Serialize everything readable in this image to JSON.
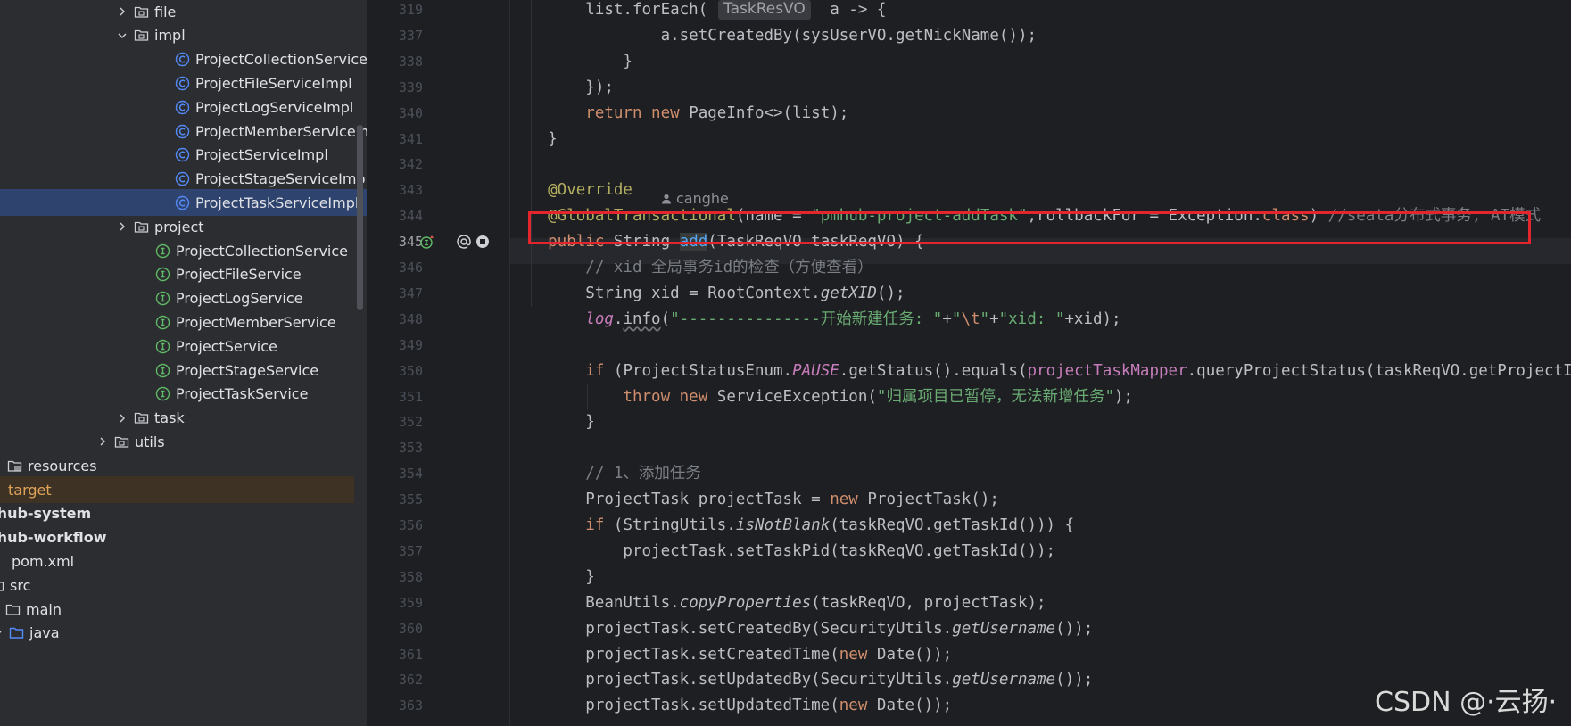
{
  "tree": [
    {
      "label": "file",
      "kind": "folder",
      "indent": 150,
      "chevron": "right"
    },
    {
      "label": "impl",
      "kind": "folder",
      "indent": 150,
      "chevron": "down"
    },
    {
      "label": "ProjectCollectionServiceImpl",
      "kind": "class",
      "indent": 196
    },
    {
      "label": "ProjectFileServiceImpl",
      "kind": "class",
      "indent": 196
    },
    {
      "label": "ProjectLogServiceImpl",
      "kind": "class",
      "indent": 196
    },
    {
      "label": "ProjectMemberServiceImpl",
      "kind": "class",
      "indent": 196
    },
    {
      "label": "ProjectServiceImpl",
      "kind": "class",
      "indent": 196
    },
    {
      "label": "ProjectStageServiceImpl",
      "kind": "class",
      "indent": 196
    },
    {
      "label": "ProjectTaskServiceImpl",
      "kind": "class",
      "indent": 196,
      "selected": true
    },
    {
      "label": "project",
      "kind": "folder",
      "indent": 150,
      "chevron": "right"
    },
    {
      "label": "ProjectCollectionService",
      "kind": "interface",
      "indent": 174
    },
    {
      "label": "ProjectFileService",
      "kind": "interface",
      "indent": 174
    },
    {
      "label": "ProjectLogService",
      "kind": "interface",
      "indent": 174
    },
    {
      "label": "ProjectMemberService",
      "kind": "interface",
      "indent": 174
    },
    {
      "label": "ProjectService",
      "kind": "interface",
      "indent": 174
    },
    {
      "label": "ProjectStageService",
      "kind": "interface",
      "indent": 174
    },
    {
      "label": "ProjectTaskService",
      "kind": "interface",
      "indent": 174
    },
    {
      "label": "task",
      "kind": "folder",
      "indent": 150,
      "chevron": "right"
    },
    {
      "label": "utils",
      "kind": "folder",
      "indent": 128,
      "chevron": "right"
    },
    {
      "label": "resources",
      "kind": "resfolder",
      "indent": 8,
      "chevron": "right"
    },
    {
      "label": "target",
      "kind": "target",
      "indent": -14,
      "target": true
    },
    {
      "label": "mhub-system",
      "kind": "module",
      "indent": -20,
      "bold": true
    },
    {
      "label": "mhub-workflow",
      "kind": "module",
      "indent": -20,
      "bold": true
    },
    {
      "label": "pom.xml",
      "kind": "pom",
      "indent": -10
    },
    {
      "label": "src",
      "kind": "folderplain",
      "indent": -12
    },
    {
      "label": "main",
      "kind": "folderplain",
      "indent": 6
    },
    {
      "label": "java",
      "kind": "bluefolder",
      "indent": 10,
      "chevron": "down"
    }
  ],
  "line_numbers": [
    "319",
    "337",
    "338",
    "339",
    "340",
    "341",
    "342",
    "343",
    "344",
    "345",
    "346",
    "347",
    "348",
    "349",
    "350",
    "351",
    "352",
    "353",
    "354",
    "355",
    "356",
    "357",
    "358",
    "359",
    "360",
    "361",
    "362",
    "363"
  ],
  "current_line": "345",
  "type_hint": "TaskResVO",
  "author_hint": "canghe",
  "watermark": "CSDN @·云扬·",
  "code": [
    [
      [
        "fn",
        "        list.forEach("
      ],
      [
        "hint",
        "            "
      ],
      [
        "fn",
        " a -> {"
      ]
    ],
    [
      [
        "fn",
        "                a.setCreatedBy(sysUserVO.getNickName());"
      ]
    ],
    [
      [
        "fn",
        "            }"
      ]
    ],
    [
      [
        "fn",
        "        });"
      ]
    ],
    [
      [
        "kw",
        "        return new "
      ],
      [
        "fn",
        "PageInfo<>(list);"
      ]
    ],
    [
      [
        "fn",
        "    }"
      ]
    ],
    [
      [
        "fn",
        ""
      ]
    ],
    [
      [
        "ann",
        "    @Override"
      ]
    ],
    [
      [
        "ann",
        "    @GlobalTransactional"
      ],
      [
        "fn",
        "(name = "
      ],
      [
        "str",
        "\"pmhub-project-addTask\""
      ],
      [
        "fn",
        ",rollbackFor = Exception."
      ],
      [
        "kw",
        "class"
      ],
      [
        "fn",
        ") "
      ],
      [
        "cmt",
        "//seata分布式事务, AT模式"
      ]
    ],
    [
      [
        "kw",
        "    public "
      ],
      [
        "fn",
        "String "
      ],
      [
        "meth",
        "add"
      ],
      [
        "fn",
        "(TaskReqVO taskReqVO) {"
      ]
    ],
    [
      [
        "cmt",
        "        // xid 全局事务id的检查（方便查看）"
      ]
    ],
    [
      [
        "fn",
        "        String xid = RootContext."
      ],
      [
        "ital",
        "getXID"
      ],
      [
        "fn",
        "();"
      ]
    ],
    [
      [
        "fld",
        "        log"
      ],
      [
        "fn",
        "."
      ],
      [
        "wavy",
        "info"
      ],
      [
        "fn",
        "("
      ],
      [
        "str",
        "\"---------------开始新建任务: \""
      ],
      [
        "fn",
        "+"
      ],
      [
        "str",
        "\""
      ],
      [
        "esc",
        "\\t"
      ],
      [
        "str",
        "\""
      ],
      [
        "fn",
        "+"
      ],
      [
        "str",
        "\"xid: \""
      ],
      [
        "fn",
        "+xid);"
      ]
    ],
    [
      [
        "fn",
        ""
      ]
    ],
    [
      [
        "kw",
        "        if "
      ],
      [
        "fn",
        "(ProjectStatusEnum."
      ],
      [
        "fld",
        "PAUSE"
      ],
      [
        "fn",
        ".getStatus().equals("
      ],
      [
        "fldn",
        "projectTaskMapper"
      ],
      [
        "fn",
        ".queryProjectStatus(taskReqVO.getProjectId()))) {"
      ]
    ],
    [
      [
        "kw",
        "            throw new "
      ],
      [
        "fn",
        "ServiceException("
      ],
      [
        "str",
        "\"归属项目已暂停，无法新增任务\""
      ],
      [
        "fn",
        ");"
      ]
    ],
    [
      [
        "fn",
        "        }"
      ]
    ],
    [
      [
        "fn",
        ""
      ]
    ],
    [
      [
        "cmt",
        "        // 1、添加任务"
      ]
    ],
    [
      [
        "fn",
        "        ProjectTask projectTask = "
      ],
      [
        "kw",
        "new "
      ],
      [
        "fn",
        "ProjectTask();"
      ]
    ],
    [
      [
        "kw",
        "        if "
      ],
      [
        "fn",
        "(StringUtils."
      ],
      [
        "ital",
        "isNotBlank"
      ],
      [
        "fn",
        "(taskReqVO.getTaskId())) {"
      ]
    ],
    [
      [
        "fn",
        "            projectTask.setTaskPid(taskReqVO.getTaskId());"
      ]
    ],
    [
      [
        "fn",
        "        }"
      ]
    ],
    [
      [
        "fn",
        "        BeanUtils."
      ],
      [
        "ital",
        "copyProperties"
      ],
      [
        "fn",
        "(taskReqVO, projectTask);"
      ]
    ],
    [
      [
        "fn",
        "        projectTask.setCreatedBy(SecurityUtils."
      ],
      [
        "ital",
        "getUsername"
      ],
      [
        "fn",
        "());"
      ]
    ],
    [
      [
        "fn",
        "        projectTask.setCreatedTime("
      ],
      [
        "kw",
        "new "
      ],
      [
        "fn",
        "Date());"
      ]
    ],
    [
      [
        "fn",
        "        projectTask.setUpdatedBy(SecurityUtils."
      ],
      [
        "ital",
        "getUsername"
      ],
      [
        "fn",
        "());"
      ]
    ],
    [
      [
        "fn",
        "        projectTask.setUpdatedTime("
      ],
      [
        "kw",
        "new "
      ],
      [
        "fn",
        "Date());"
      ]
    ]
  ],
  "colors": {
    "keyword": "#cf8e6d",
    "string": "#6aab73",
    "annotation": "#b3ae60",
    "comment": "#7a7e85",
    "field": "#c77dbb",
    "highlight_border": "#e3262e",
    "selection": "#2e436e"
  }
}
